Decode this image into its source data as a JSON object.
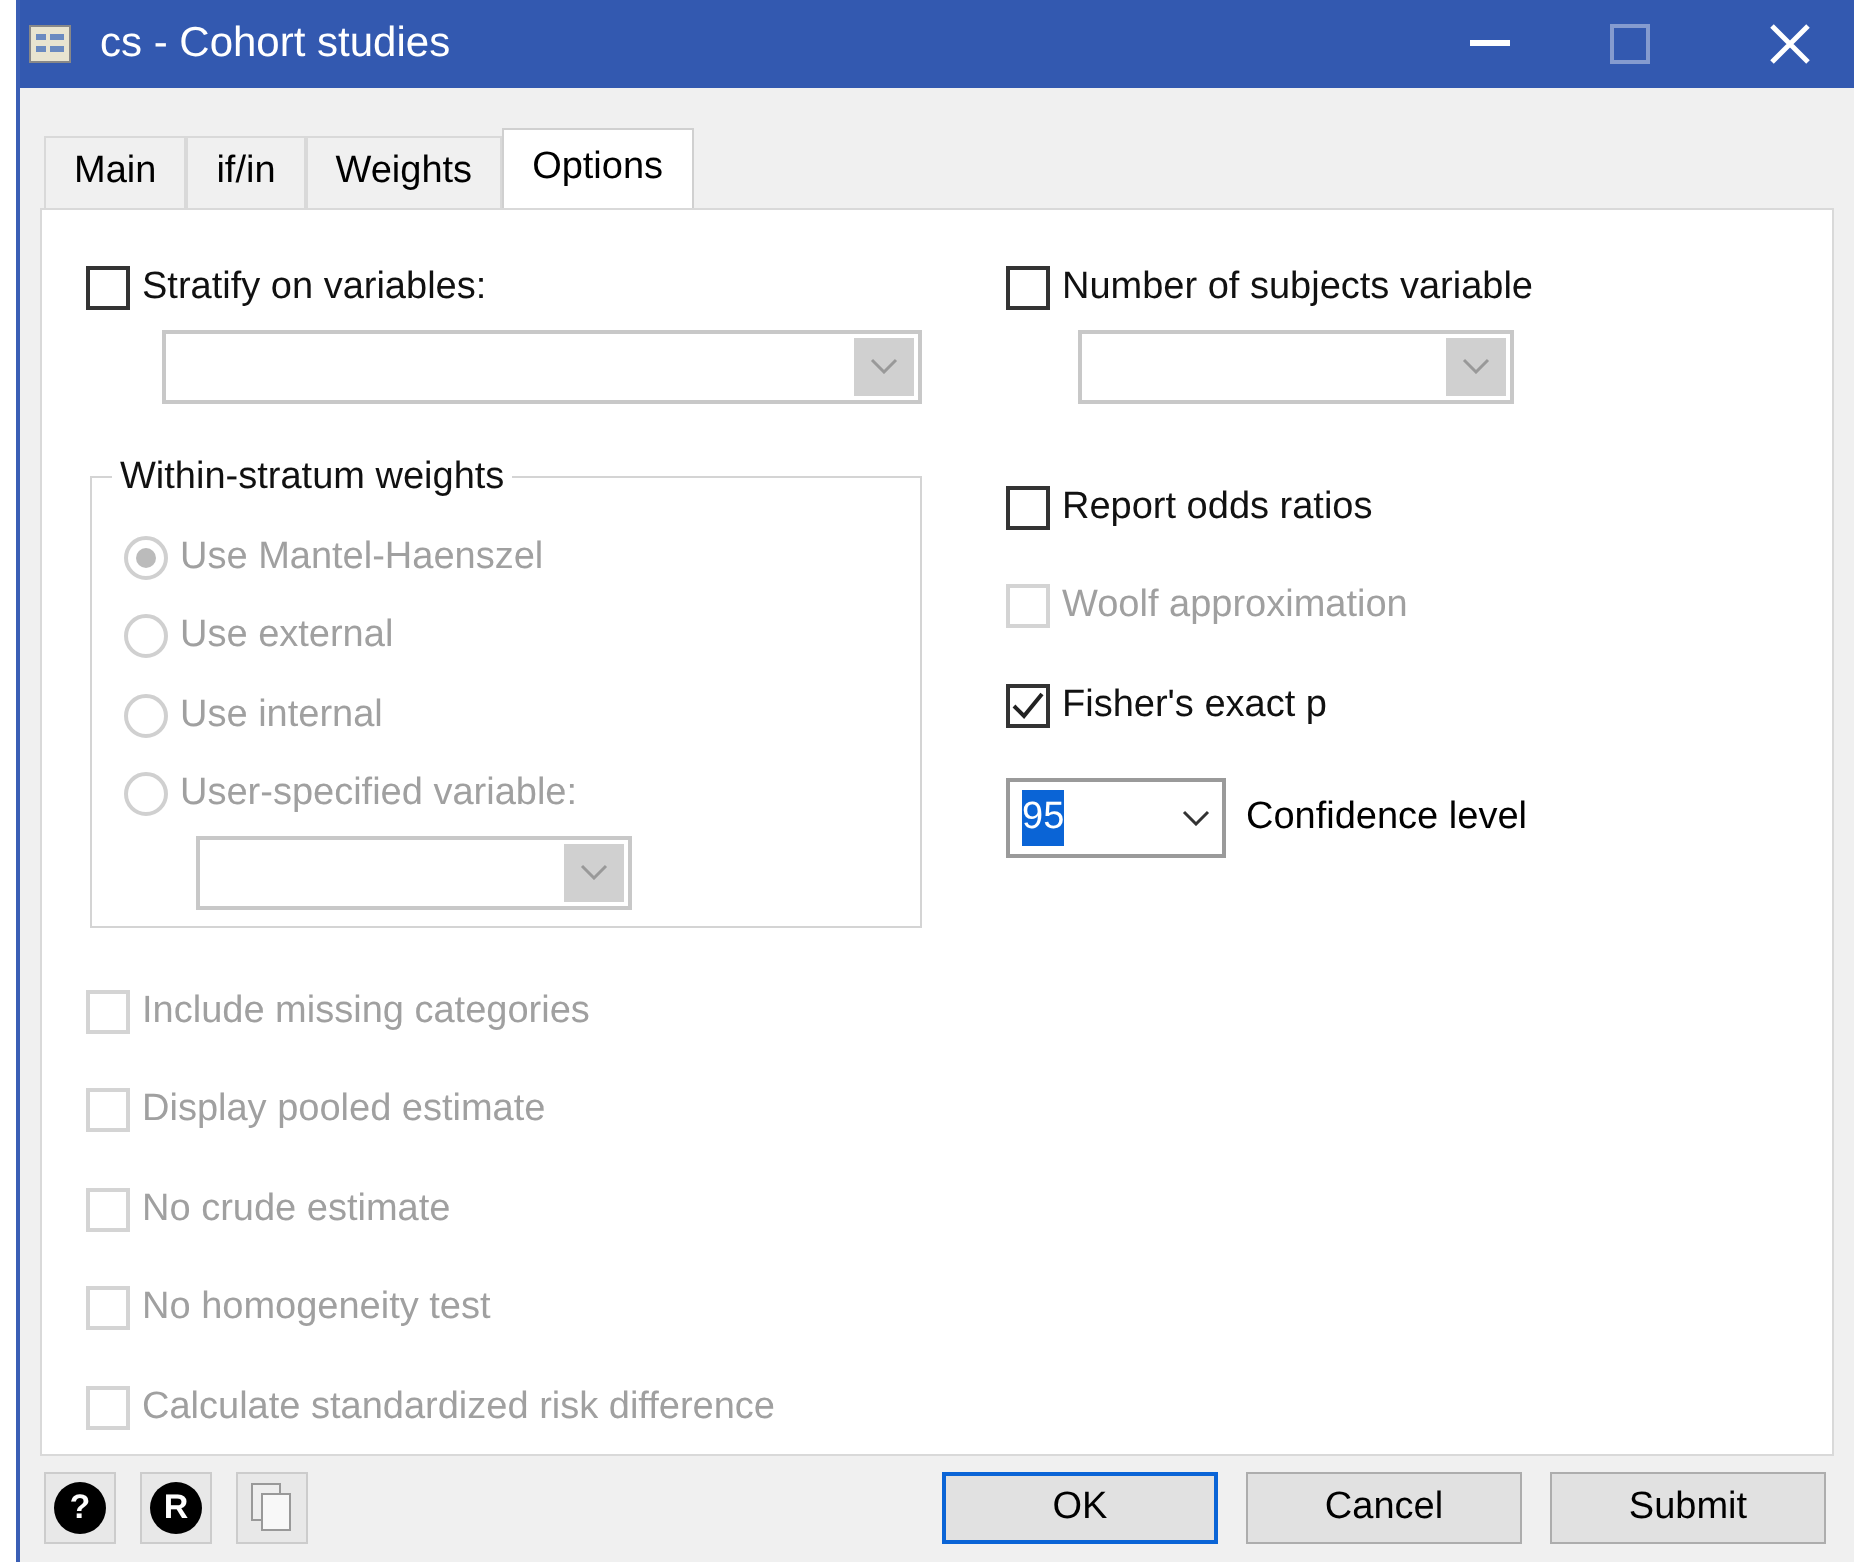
{
  "window": {
    "title": "cs - Cohort studies"
  },
  "tabs": [
    {
      "label": "Main",
      "selected": false
    },
    {
      "label": "if/in",
      "selected": false
    },
    {
      "label": "Weights",
      "selected": false
    },
    {
      "label": "Options",
      "selected": true
    }
  ],
  "stratify": {
    "label": "Stratify on variables:",
    "checked": false
  },
  "weights_group": {
    "title": "Within-stratum weights",
    "disabled": true,
    "options": [
      {
        "label": "Use Mantel-Haenszel",
        "selected": true
      },
      {
        "label": "Use external",
        "selected": false
      },
      {
        "label": "Use internal",
        "selected": false
      },
      {
        "label": "User-specified variable:",
        "selected": false
      }
    ]
  },
  "left_checks": [
    {
      "label": "Include missing categories",
      "checked": false,
      "disabled": true
    },
    {
      "label": "Display pooled estimate",
      "checked": false,
      "disabled": true
    },
    {
      "label": "No crude estimate",
      "checked": false,
      "disabled": true
    },
    {
      "label": "No homogeneity test",
      "checked": false,
      "disabled": true
    },
    {
      "label": "Calculate standardized risk difference",
      "checked": false,
      "disabled": true
    }
  ],
  "subjects": {
    "label": "Number of subjects variable",
    "checked": false
  },
  "right_checks": [
    {
      "label": "Report odds ratios",
      "checked": false,
      "disabled": false
    },
    {
      "label": "Woolf approximation",
      "checked": false,
      "disabled": true
    },
    {
      "label": "Fisher's exact p",
      "checked": true,
      "disabled": false
    }
  ],
  "confidence": {
    "value": "95",
    "label": "Confidence level"
  },
  "footer_icons": [
    {
      "kind": "help",
      "text": "?"
    },
    {
      "kind": "r",
      "text": "R"
    },
    {
      "kind": "copy"
    }
  ],
  "buttons": [
    {
      "label": "OK",
      "default": true
    },
    {
      "label": "Cancel",
      "default": false
    },
    {
      "label": "Submit",
      "default": false
    }
  ]
}
